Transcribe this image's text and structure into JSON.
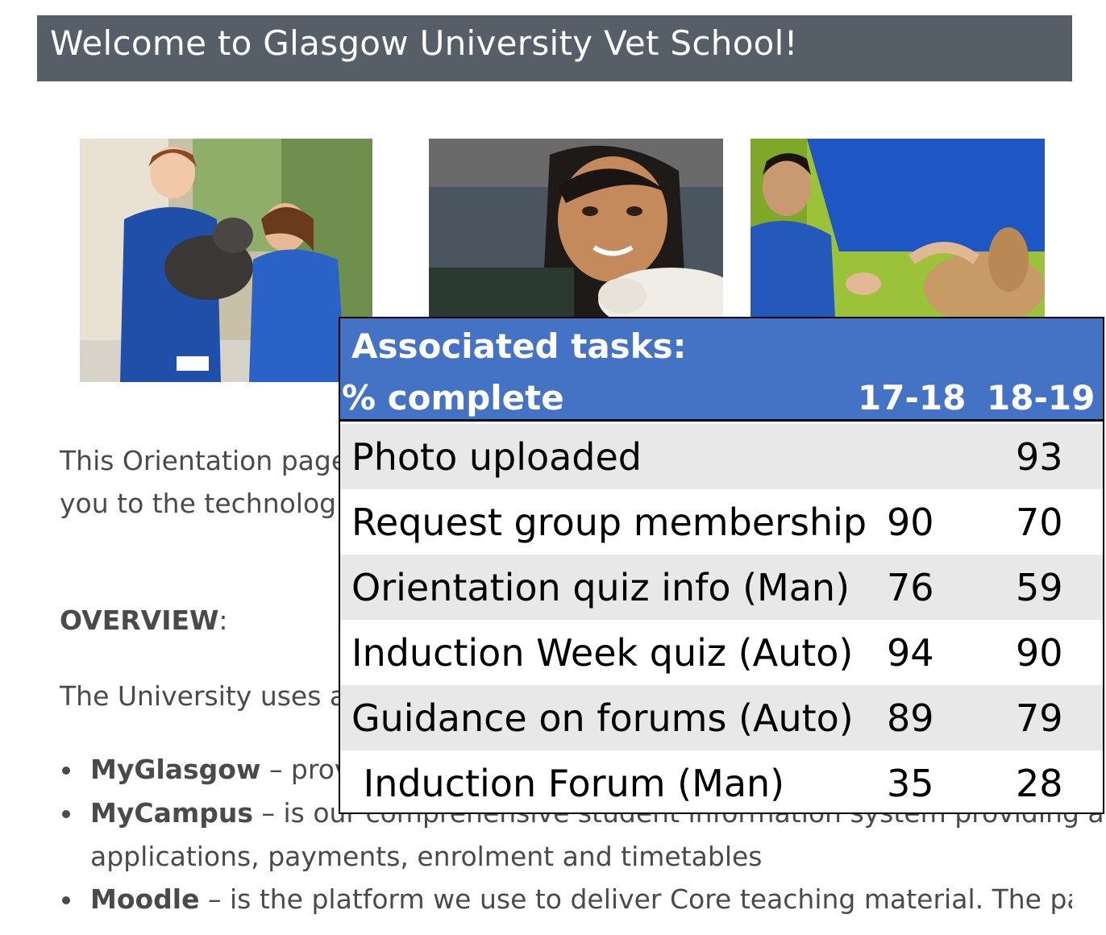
{
  "banner": {
    "title": "Welcome to Glasgow University Vet School!"
  },
  "photos": [
    "vet-students-examining-dog-photo",
    "student-selfie-with-lamb-photo",
    "vet-student-examining-rabbit-photo"
  ],
  "page": {
    "intro_line1": "This Orientation page",
    "intro_line2": "you to the technologi",
    "overview_heading": "OVERVIEW",
    "overview_colon": ":",
    "university_text": "The University uses a",
    "bullets": [
      {
        "name": "MyGlasgow",
        "text": " – prov"
      },
      {
        "name": "MyCampus",
        "text": " – is our comprehensive student information system providing a"
      },
      {
        "name": "",
        "text": "applications, payments, enrolment and timetables"
      },
      {
        "name": "Moodle",
        "text": " – is the platform we use to deliver Core teaching material. The page"
      }
    ]
  },
  "table": {
    "header_line1": "Associated tasks:",
    "header_line2": "% complete",
    "col1": "17-18",
    "col2": "18-19",
    "header_color": "#4472c4",
    "rows": [
      {
        "task": "Photo uploaded",
        "v1": "",
        "v2": "93"
      },
      {
        "task": "Request group membership",
        "v1": "90",
        "v2": "70"
      },
      {
        "task": "Orientation quiz info (Man)",
        "v1": "76",
        "v2": "59"
      },
      {
        "task": "Induction Week quiz (Auto)",
        "v1": "94",
        "v2": "90"
      },
      {
        "task": "Guidance on forums (Auto)",
        "v1": "89",
        "v2": "79"
      },
      {
        "task": " Induction Forum (Man)",
        "v1": "35",
        "v2": "28"
      }
    ]
  }
}
